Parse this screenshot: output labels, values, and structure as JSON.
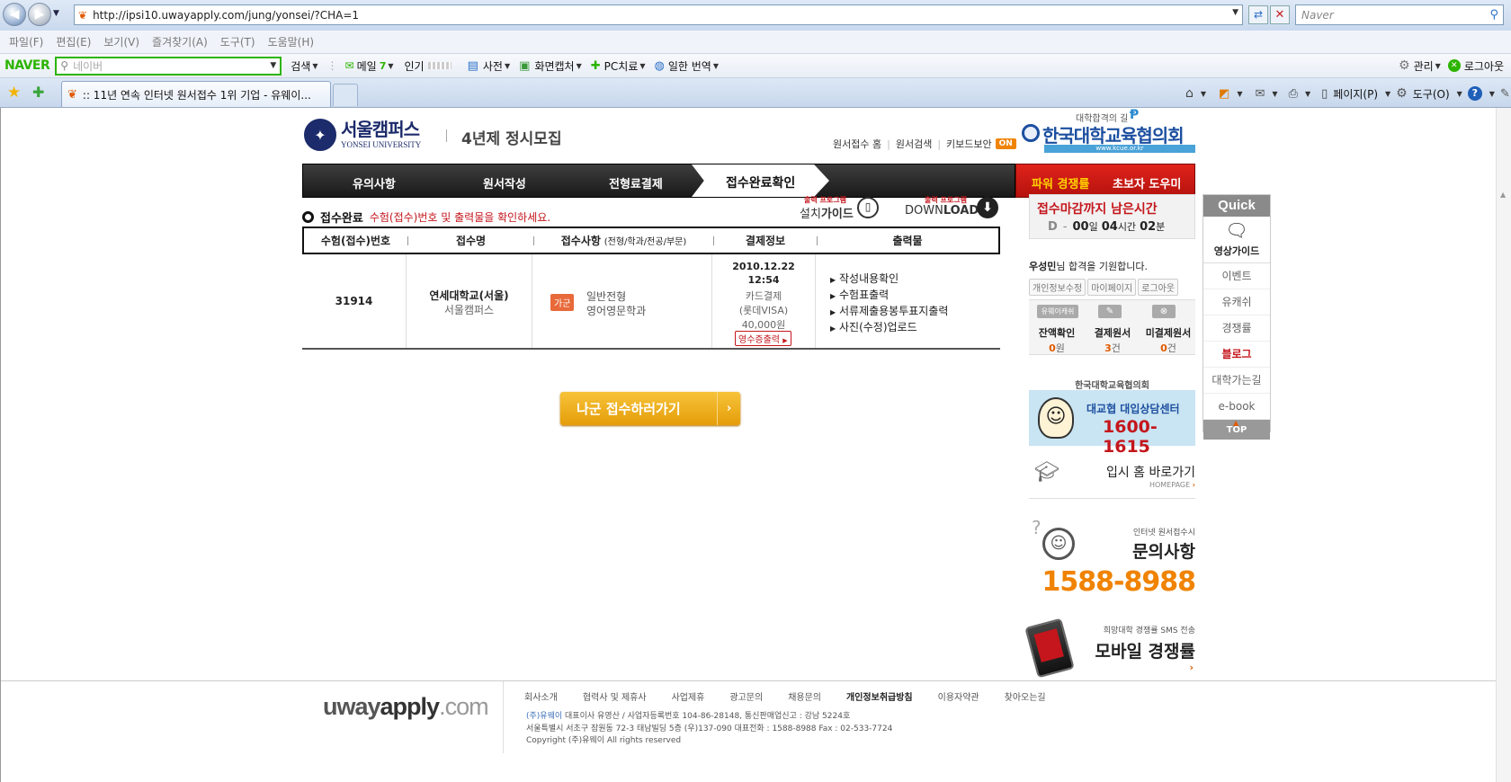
{
  "browser": {
    "url": "http://ipsi10.uwayapply.com/jung/yonsei/?CHA=1",
    "search_placeholder": "Naver",
    "menus": [
      "파일(F)",
      "편집(E)",
      "보기(V)",
      "즐겨찾기(A)",
      "도구(T)",
      "도움말(H)"
    ],
    "toolbar": {
      "brand": "NAVER",
      "search_placeholder": "네이버",
      "search_label": "검색",
      "mail_label": "메일",
      "mail_count": "7",
      "popular_label": "인기",
      "dict_label": "사전",
      "capture_label": "화면캡처",
      "pc_label": "PC치료",
      "translate_label": "일한 번역",
      "manage_label": "관리",
      "logout_label": "로그아웃"
    },
    "tab_title": ":: 11년 연속 인터넷 원서접수 1위 기업 - 유웨이...",
    "cmd": {
      "page_label": "페이지(P)",
      "tools_label": "도구(O)"
    }
  },
  "header": {
    "campus_label": "서울캠퍼스",
    "university_en": "YONSEI UNIVERSITY",
    "admission_title": "4년제 정시모집",
    "top_links": [
      "원서접수 홈",
      "원서검색",
      "키보드보안"
    ],
    "on_badge": "ON",
    "kcue_slogan": "대학합격의 길",
    "kcue_name": "한국대학교육협의회",
    "kcue_url": "www.kcue.or.kr"
  },
  "nav": {
    "steps": [
      "유의사항",
      "원서작성",
      "전형료결제",
      "접수완료확인"
    ],
    "side_buttons": [
      "파워 경쟁률",
      "초보자 도우미"
    ]
  },
  "status": {
    "title": "접수완료",
    "desc": "수험(접수)번호 및 출력물을 확인하세요.",
    "prog_label_small": "출력 프로그램",
    "install_a": "설치",
    "install_b": "가이드",
    "download_a": "DOWN",
    "download_b": "LOAD"
  },
  "table": {
    "headers": [
      "수험(접수)번호",
      "접수명",
      "접수사항",
      "결제정보",
      "출력물"
    ],
    "header_sub": "(전형/학과/전공/부문)",
    "row": {
      "number": "31914",
      "school": "연세대학교(서울)",
      "campus": "서울캠퍼스",
      "group_badge": "가군",
      "track": "일반전형",
      "dept": "영어영문학과",
      "date": "2010.12.22",
      "time": "12:54",
      "method": "카드결제",
      "card": "(롯데VISA)",
      "amount": "40,000원",
      "receipt_btn": "영수증출력",
      "outputs": [
        "작성내용확인",
        "수험표출력",
        "서류제출용봉투표지출력",
        "사진(수정)업로드"
      ]
    }
  },
  "next_button": "나군 접수하러가기",
  "sidebar": {
    "deadline_title": "접수마감까지 남은시간",
    "d_label": "D",
    "d_dash": "-",
    "d_days": "00",
    "d_day_unit": "일",
    "d_hours": "04",
    "d_hour_unit": "시간",
    "d_mins": "02",
    "d_min_unit": "분",
    "user_name": "우성민",
    "user_msg": "님 합격을 기원합니다.",
    "user_buttons": [
      "개인정보수정",
      "마이페이지",
      "로그아웃"
    ],
    "wallet_label": "유웨이캐쉬",
    "wallet": [
      {
        "label": "잔액확인",
        "value": "0",
        "unit": "원"
      },
      {
        "label": "결제원서",
        "value": "3",
        "unit": "건"
      },
      {
        "label": "미결제원서",
        "value": "0",
        "unit": "건"
      }
    ],
    "kcue_label": "한국대학교육협의회",
    "kcue_center": "대교협 대입상담센터",
    "kcue_phone": "1600-1615",
    "home_title": "입시 홈 바로가기",
    "home_sub": "HOMEPAGE",
    "inquiry_small": "인터넷 원서접수시",
    "inquiry_title": "문의사항",
    "inquiry_phone": "1588-8988",
    "mobile_small": "희망대학 경쟁률 SMS 전송",
    "mobile_title": "모바일 경쟁률"
  },
  "quick": {
    "title": "Quick",
    "guide_label": "영상가이드",
    "items": [
      "이벤트",
      "유캐쉬",
      "경쟁률",
      "블로그",
      "대학가는길",
      "e-book"
    ],
    "top": "TOP"
  },
  "footer": {
    "logo_a": "uway",
    "logo_b": "apply",
    "logo_c": ".com",
    "links": [
      "회사소개",
      "협력사 및 제휴사",
      "사업제휴",
      "광고문의",
      "채용문의",
      "개인정보취급방침",
      "이용자약관",
      "찾아오는길"
    ],
    "company": "(주)유웨이",
    "line1": "대표이사 유영산  /  사업자등록번호 104-86-28148, 통신판매업신고 : 강남 5224호",
    "line2": "서울특별시 서초구 잠원동 72-3 태남빌딩 5층  (우)137-090 대표전화 : 1588-8988  Fax : 02-533-7724",
    "line3": "Copyright (주)유웨이 All rights reserved"
  },
  "colors": {
    "accent_red": "#c4161c",
    "orange": "#f08300",
    "nav_dark": "#222222",
    "yellow_btn": "#efae1c"
  }
}
